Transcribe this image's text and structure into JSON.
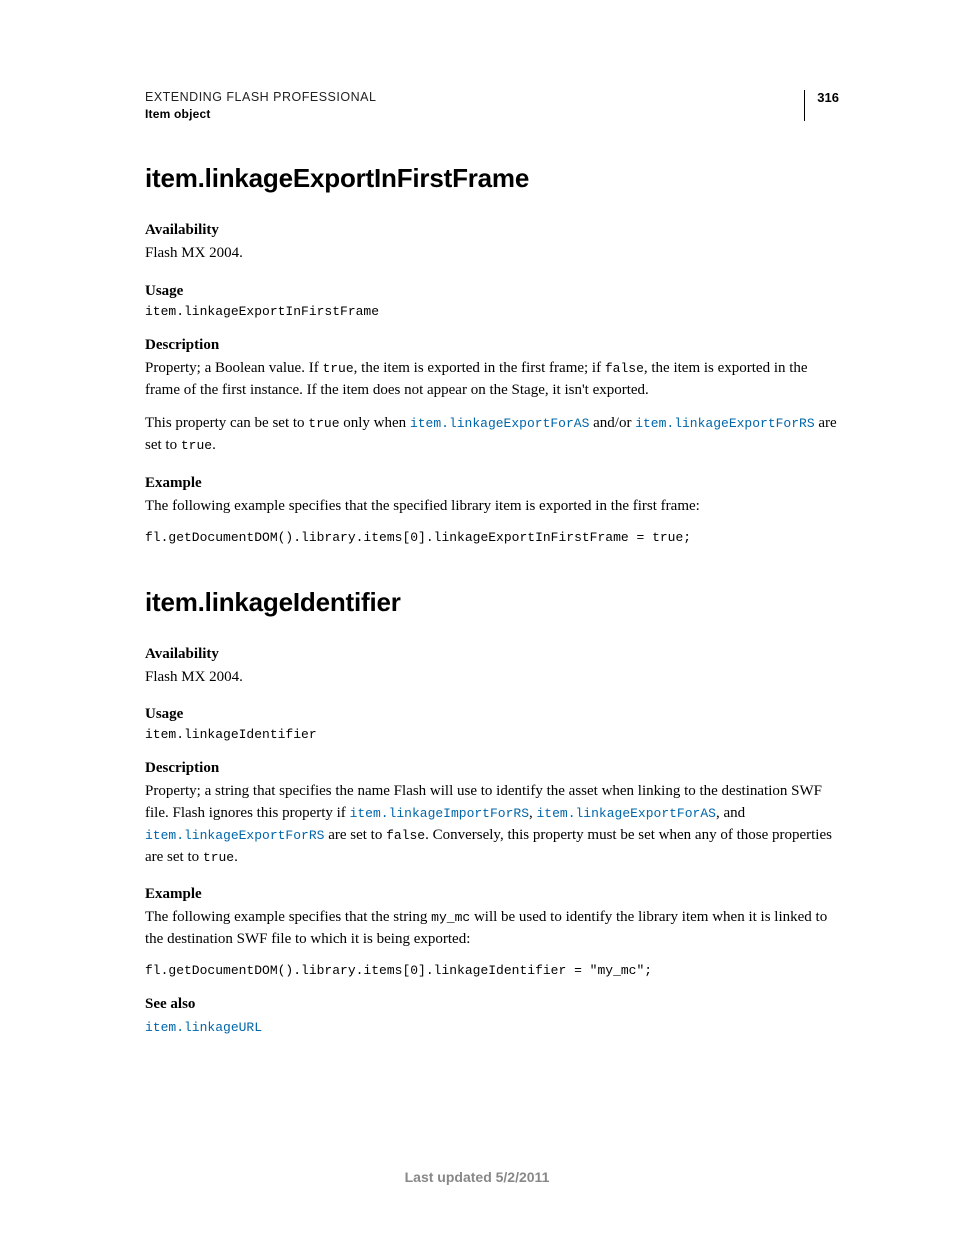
{
  "header": {
    "chapter": "EXTENDING FLASH PROFESSIONAL",
    "section": "Item object",
    "page_number": "316"
  },
  "sections": [
    {
      "title": "item.linkageExportInFirstFrame",
      "availability_label": "Availability",
      "availability_text": "Flash MX 2004.",
      "usage_label": "Usage",
      "usage_code": "item.linkageExportInFirstFrame",
      "description_label": "Description",
      "description_para1_pre": "Property; a Boolean value. If ",
      "description_para1_code1": "true",
      "description_para1_mid1": ", the item is exported in the first frame; if ",
      "description_para1_code2": "false",
      "description_para1_post1": ", the item is exported in the frame of the first instance. If the item does not appear on the Stage, it isn't exported.",
      "description_para2_pre": "This property can be set to ",
      "description_para2_code1": "true",
      "description_para2_mid1": " only when ",
      "description_para2_link1": "item.linkageExportForAS",
      "description_para2_mid2": " and/or ",
      "description_para2_link2": "item.linkageExportForRS",
      "description_para2_mid3": " are set to ",
      "description_para2_code2": "true",
      "description_para2_post": ".",
      "example_label": "Example",
      "example_text": "The following example specifies that the specified library item is exported in the first frame:",
      "example_code": "fl.getDocumentDOM().library.items[0].linkageExportInFirstFrame = true;"
    },
    {
      "title": "item.linkageIdentifier",
      "availability_label": "Availability",
      "availability_text": "Flash MX 2004.",
      "usage_label": "Usage",
      "usage_code": "item.linkageIdentifier",
      "description_label": "Description",
      "description_para1_pre": "Property; a string that specifies the name Flash will use to identify the asset when linking to the destination SWF file. Flash ignores this property if ",
      "description_para1_link1": "item.linkageImportForRS",
      "description_para1_sep1": ", ",
      "description_para1_link2": "item.linkageExportForAS",
      "description_para1_sep2": ", and ",
      "description_para1_link3": "item.linkageExportForRS",
      "description_para1_mid": " are set to ",
      "description_para1_code1": "false",
      "description_para1_mid2": ". Conversely, this property must be set when any of those properties are set to ",
      "description_para1_code2": "true",
      "description_para1_post": ".",
      "example_label": "Example",
      "example_text_pre": "The following example specifies that the string ",
      "example_text_code": "my_mc",
      "example_text_post": " will be used to identify the library item when it is linked to the destination SWF file to which it is being exported:",
      "example_code": "fl.getDocumentDOM().library.items[0].linkageIdentifier = \"my_mc\";",
      "seealso_label": "See also",
      "seealso_link": "item.linkageURL"
    }
  ],
  "footer": "Last updated 5/2/2011"
}
